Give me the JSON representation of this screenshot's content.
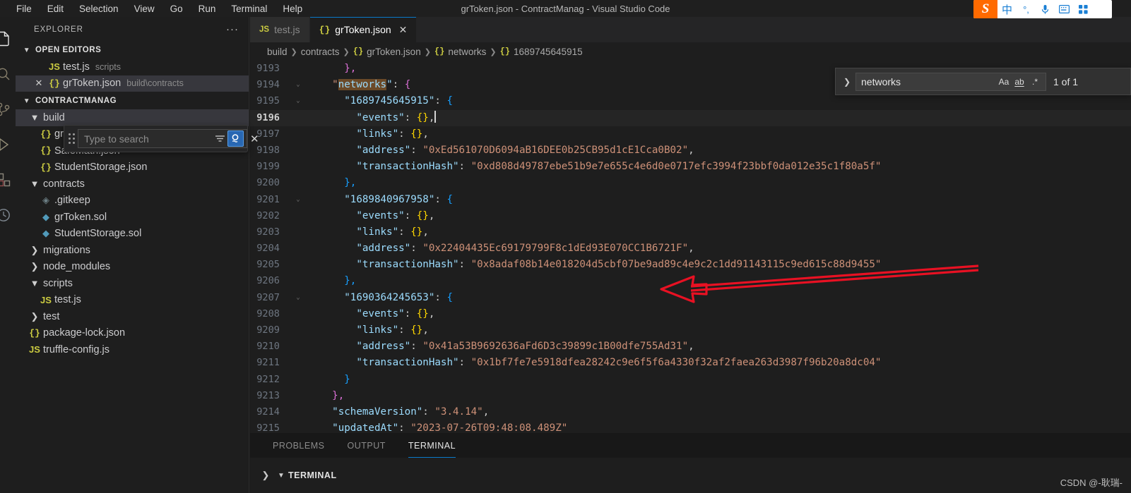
{
  "titlebar": {
    "menus": [
      "File",
      "Edit",
      "Selection",
      "View",
      "Go",
      "Run",
      "Terminal",
      "Help"
    ],
    "window_title": "grToken.json - ContractManag - Visual Studio Code"
  },
  "ime": {
    "logo": "S",
    "icons": [
      "中",
      "°,",
      "mic-icon",
      "keyboard-icon",
      "apps-grid-icon"
    ]
  },
  "activitybar": {
    "items": [
      {
        "name": "explorer",
        "icon": "files-icon",
        "active": true
      },
      {
        "name": "search",
        "icon": "search-icon",
        "active": false
      },
      {
        "name": "source-control",
        "icon": "source-control-icon",
        "active": false
      },
      {
        "name": "run-debug",
        "icon": "run-debug-icon",
        "active": false
      },
      {
        "name": "extensions",
        "icon": "extensions-icon",
        "active": false
      },
      {
        "name": "remote",
        "icon": "remote-icon",
        "active": false
      }
    ]
  },
  "sidebar": {
    "title": "EXPLORER",
    "more_actions": "···",
    "open_editors": {
      "label": "OPEN EDITORS",
      "items": [
        {
          "icon": "js",
          "name": "test.js",
          "desc": "scripts",
          "selected": false,
          "dirty": false
        },
        {
          "icon": "json",
          "name": "grToken.json",
          "desc": "build\\contracts",
          "selected": true,
          "dirty": false
        }
      ]
    },
    "workspace": {
      "label": "CONTRACTMANAG",
      "items": [
        {
          "icon": "folder-open",
          "name": "build",
          "indent": 1,
          "selected": true
        },
        {
          "icon": "json",
          "name": "grToken.json",
          "indent": 2
        },
        {
          "icon": "json",
          "name": "SafeMath.json",
          "indent": 2
        },
        {
          "icon": "json",
          "name": "StudentStorage.json",
          "indent": 2
        },
        {
          "icon": "folder-open",
          "name": "contracts",
          "indent": 1
        },
        {
          "icon": "git",
          "name": ".gitkeep",
          "indent": 2
        },
        {
          "icon": "sol",
          "name": "grToken.sol",
          "indent": 2
        },
        {
          "icon": "sol",
          "name": "StudentStorage.sol",
          "indent": 2
        },
        {
          "icon": "folder-closed",
          "name": "migrations",
          "indent": 1
        },
        {
          "icon": "folder-closed",
          "name": "node_modules",
          "indent": 1
        },
        {
          "icon": "folder-open",
          "name": "scripts",
          "indent": 1
        },
        {
          "icon": "js",
          "name": "test.js",
          "indent": 2
        },
        {
          "icon": "folder-closed",
          "name": "test",
          "indent": 1
        },
        {
          "icon": "json",
          "name": "package-lock.json",
          "indent": 1
        },
        {
          "icon": "js",
          "name": "truffle-config.js",
          "indent": 1
        }
      ]
    }
  },
  "search_overlay": {
    "placeholder": "Type to search",
    "value": "",
    "filter_icon": "filter-icon",
    "search_icon": "magnifier-icon",
    "close_icon": "close-icon"
  },
  "editor": {
    "tabs": [
      {
        "icon": "js",
        "label": "test.js",
        "active": false,
        "closable": false
      },
      {
        "icon": "json",
        "label": "grToken.json",
        "active": true,
        "closable": true
      }
    ],
    "breadcrumb": [
      "build",
      "contracts",
      "grToken.json",
      "networks",
      "1689745645915"
    ],
    "current_line": 9196,
    "lines": [
      {
        "n": 9193,
        "fold": "",
        "segs": [
          {
            "t": "      ",
            "c": "p"
          },
          {
            "t": "},",
            "c": "b2"
          }
        ]
      },
      {
        "n": 9194,
        "fold": "v",
        "segs": [
          {
            "t": "    \"",
            "c": "s"
          },
          {
            "t": "networks",
            "c": "hl"
          },
          {
            "t": "\"",
            "c": "k"
          },
          {
            "t": ": ",
            "c": "p"
          },
          {
            "t": "{",
            "c": "b2"
          }
        ]
      },
      {
        "n": 9195,
        "fold": "v",
        "segs": [
          {
            "t": "      \"1689745645915\"",
            "c": "k"
          },
          {
            "t": ": ",
            "c": "p"
          },
          {
            "t": "{",
            "c": "b3"
          }
        ]
      },
      {
        "n": 9196,
        "fold": "",
        "segs": [
          {
            "t": "        \"events\"",
            "c": "k"
          },
          {
            "t": ": ",
            "c": "p"
          },
          {
            "t": "{}",
            "c": "b1"
          },
          {
            "t": ",",
            "c": "p"
          }
        ],
        "cursor": true
      },
      {
        "n": 9197,
        "fold": "",
        "segs": [
          {
            "t": "        \"links\"",
            "c": "k"
          },
          {
            "t": ": ",
            "c": "p"
          },
          {
            "t": "{}",
            "c": "b1"
          },
          {
            "t": ",",
            "c": "p"
          }
        ]
      },
      {
        "n": 9198,
        "fold": "",
        "segs": [
          {
            "t": "        \"address\"",
            "c": "k"
          },
          {
            "t": ": ",
            "c": "p"
          },
          {
            "t": "\"0xEd561070D6094aB16DEE0b25CB95d1cE1Cca0B02\"",
            "c": "s"
          },
          {
            "t": ",",
            "c": "p"
          }
        ]
      },
      {
        "n": 9199,
        "fold": "",
        "segs": [
          {
            "t": "        \"transactionHash\"",
            "c": "k"
          },
          {
            "t": ": ",
            "c": "p"
          },
          {
            "t": "\"0xd808d49787ebe51b9e7e655c4e6d0e0717efc3994f23bbf0da012e35c1f80a5f\"",
            "c": "s"
          }
        ]
      },
      {
        "n": 9200,
        "fold": "",
        "segs": [
          {
            "t": "      ",
            "c": "p"
          },
          {
            "t": "},",
            "c": "b3"
          }
        ]
      },
      {
        "n": 9201,
        "fold": "v",
        "segs": [
          {
            "t": "      \"1689840967958\"",
            "c": "k"
          },
          {
            "t": ": ",
            "c": "p"
          },
          {
            "t": "{",
            "c": "b3"
          }
        ]
      },
      {
        "n": 9202,
        "fold": "",
        "segs": [
          {
            "t": "        \"events\"",
            "c": "k"
          },
          {
            "t": ": ",
            "c": "p"
          },
          {
            "t": "{}",
            "c": "b1"
          },
          {
            "t": ",",
            "c": "p"
          }
        ]
      },
      {
        "n": 9203,
        "fold": "",
        "segs": [
          {
            "t": "        \"links\"",
            "c": "k"
          },
          {
            "t": ": ",
            "c": "p"
          },
          {
            "t": "{}",
            "c": "b1"
          },
          {
            "t": ",",
            "c": "p"
          }
        ]
      },
      {
        "n": 9204,
        "fold": "",
        "segs": [
          {
            "t": "        \"address\"",
            "c": "k"
          },
          {
            "t": ": ",
            "c": "p"
          },
          {
            "t": "\"0x22404435Ec69179799F8c1dEd93E070CC1B6721F\"",
            "c": "s"
          },
          {
            "t": ",",
            "c": "p"
          }
        ]
      },
      {
        "n": 9205,
        "fold": "",
        "segs": [
          {
            "t": "        \"transactionHash\"",
            "c": "k"
          },
          {
            "t": ": ",
            "c": "p"
          },
          {
            "t": "\"0x8adaf08b14e018204d5cbf07be9ad89c4e9c2c1dd91143115c9ed615c88d9455\"",
            "c": "s"
          }
        ]
      },
      {
        "n": 9206,
        "fold": "",
        "segs": [
          {
            "t": "      ",
            "c": "p"
          },
          {
            "t": "},",
            "c": "b3"
          }
        ]
      },
      {
        "n": 9207,
        "fold": "v",
        "segs": [
          {
            "t": "      \"1690364245653\"",
            "c": "k"
          },
          {
            "t": ": ",
            "c": "p"
          },
          {
            "t": "{",
            "c": "b3"
          }
        ]
      },
      {
        "n": 9208,
        "fold": "",
        "segs": [
          {
            "t": "        \"events\"",
            "c": "k"
          },
          {
            "t": ": ",
            "c": "p"
          },
          {
            "t": "{}",
            "c": "b1"
          },
          {
            "t": ",",
            "c": "p"
          }
        ]
      },
      {
        "n": 9209,
        "fold": "",
        "segs": [
          {
            "t": "        \"links\"",
            "c": "k"
          },
          {
            "t": ": ",
            "c": "p"
          },
          {
            "t": "{}",
            "c": "b1"
          },
          {
            "t": ",",
            "c": "p"
          }
        ]
      },
      {
        "n": 9210,
        "fold": "",
        "segs": [
          {
            "t": "        \"address\"",
            "c": "k"
          },
          {
            "t": ": ",
            "c": "p"
          },
          {
            "t": "\"0x41a53B9692636aFd6D3c39899c1B00dfe755Ad31\"",
            "c": "s"
          },
          {
            "t": ",",
            "c": "p"
          }
        ]
      },
      {
        "n": 9211,
        "fold": "",
        "segs": [
          {
            "t": "        \"transactionHash\"",
            "c": "k"
          },
          {
            "t": ": ",
            "c": "p"
          },
          {
            "t": "\"0x1bf7fe7e5918dfea28242c9e6f5f6a4330f32af2faea263d3987f96b20a8dc04\"",
            "c": "s"
          }
        ]
      },
      {
        "n": 9212,
        "fold": "",
        "segs": [
          {
            "t": "      ",
            "c": "p"
          },
          {
            "t": "}",
            "c": "b3"
          }
        ]
      },
      {
        "n": 9213,
        "fold": "",
        "segs": [
          {
            "t": "    ",
            "c": "p"
          },
          {
            "t": "},",
            "c": "b2"
          }
        ]
      },
      {
        "n": 9214,
        "fold": "",
        "segs": [
          {
            "t": "    \"schemaVersion\"",
            "c": "k"
          },
          {
            "t": ": ",
            "c": "p"
          },
          {
            "t": "\"3.4.14\"",
            "c": "s"
          },
          {
            "t": ",",
            "c": "p"
          }
        ]
      },
      {
        "n": 9215,
        "fold": "",
        "segs": [
          {
            "t": "    \"updatedAt\"",
            "c": "k"
          },
          {
            "t": ": ",
            "c": "p"
          },
          {
            "t": "\"2023-07-26T09:48:08.489Z\"",
            "c": "s"
          }
        ]
      }
    ]
  },
  "find_widget": {
    "expand_icon": "chevron-right-icon",
    "value": "networks",
    "match_case": "Aa",
    "whole_word": "ab",
    "regex": ".*",
    "count": "1 of 1"
  },
  "panel": {
    "tabs": [
      {
        "label": "PROBLEMS",
        "active": false
      },
      {
        "label": "OUTPUT",
        "active": false
      },
      {
        "label": "TERMINAL",
        "active": true
      }
    ],
    "terminal_label": "TERMINAL"
  },
  "annotation": {
    "arrow_color": "#e81123"
  },
  "watermark": "CSDN @-耿瑞-"
}
